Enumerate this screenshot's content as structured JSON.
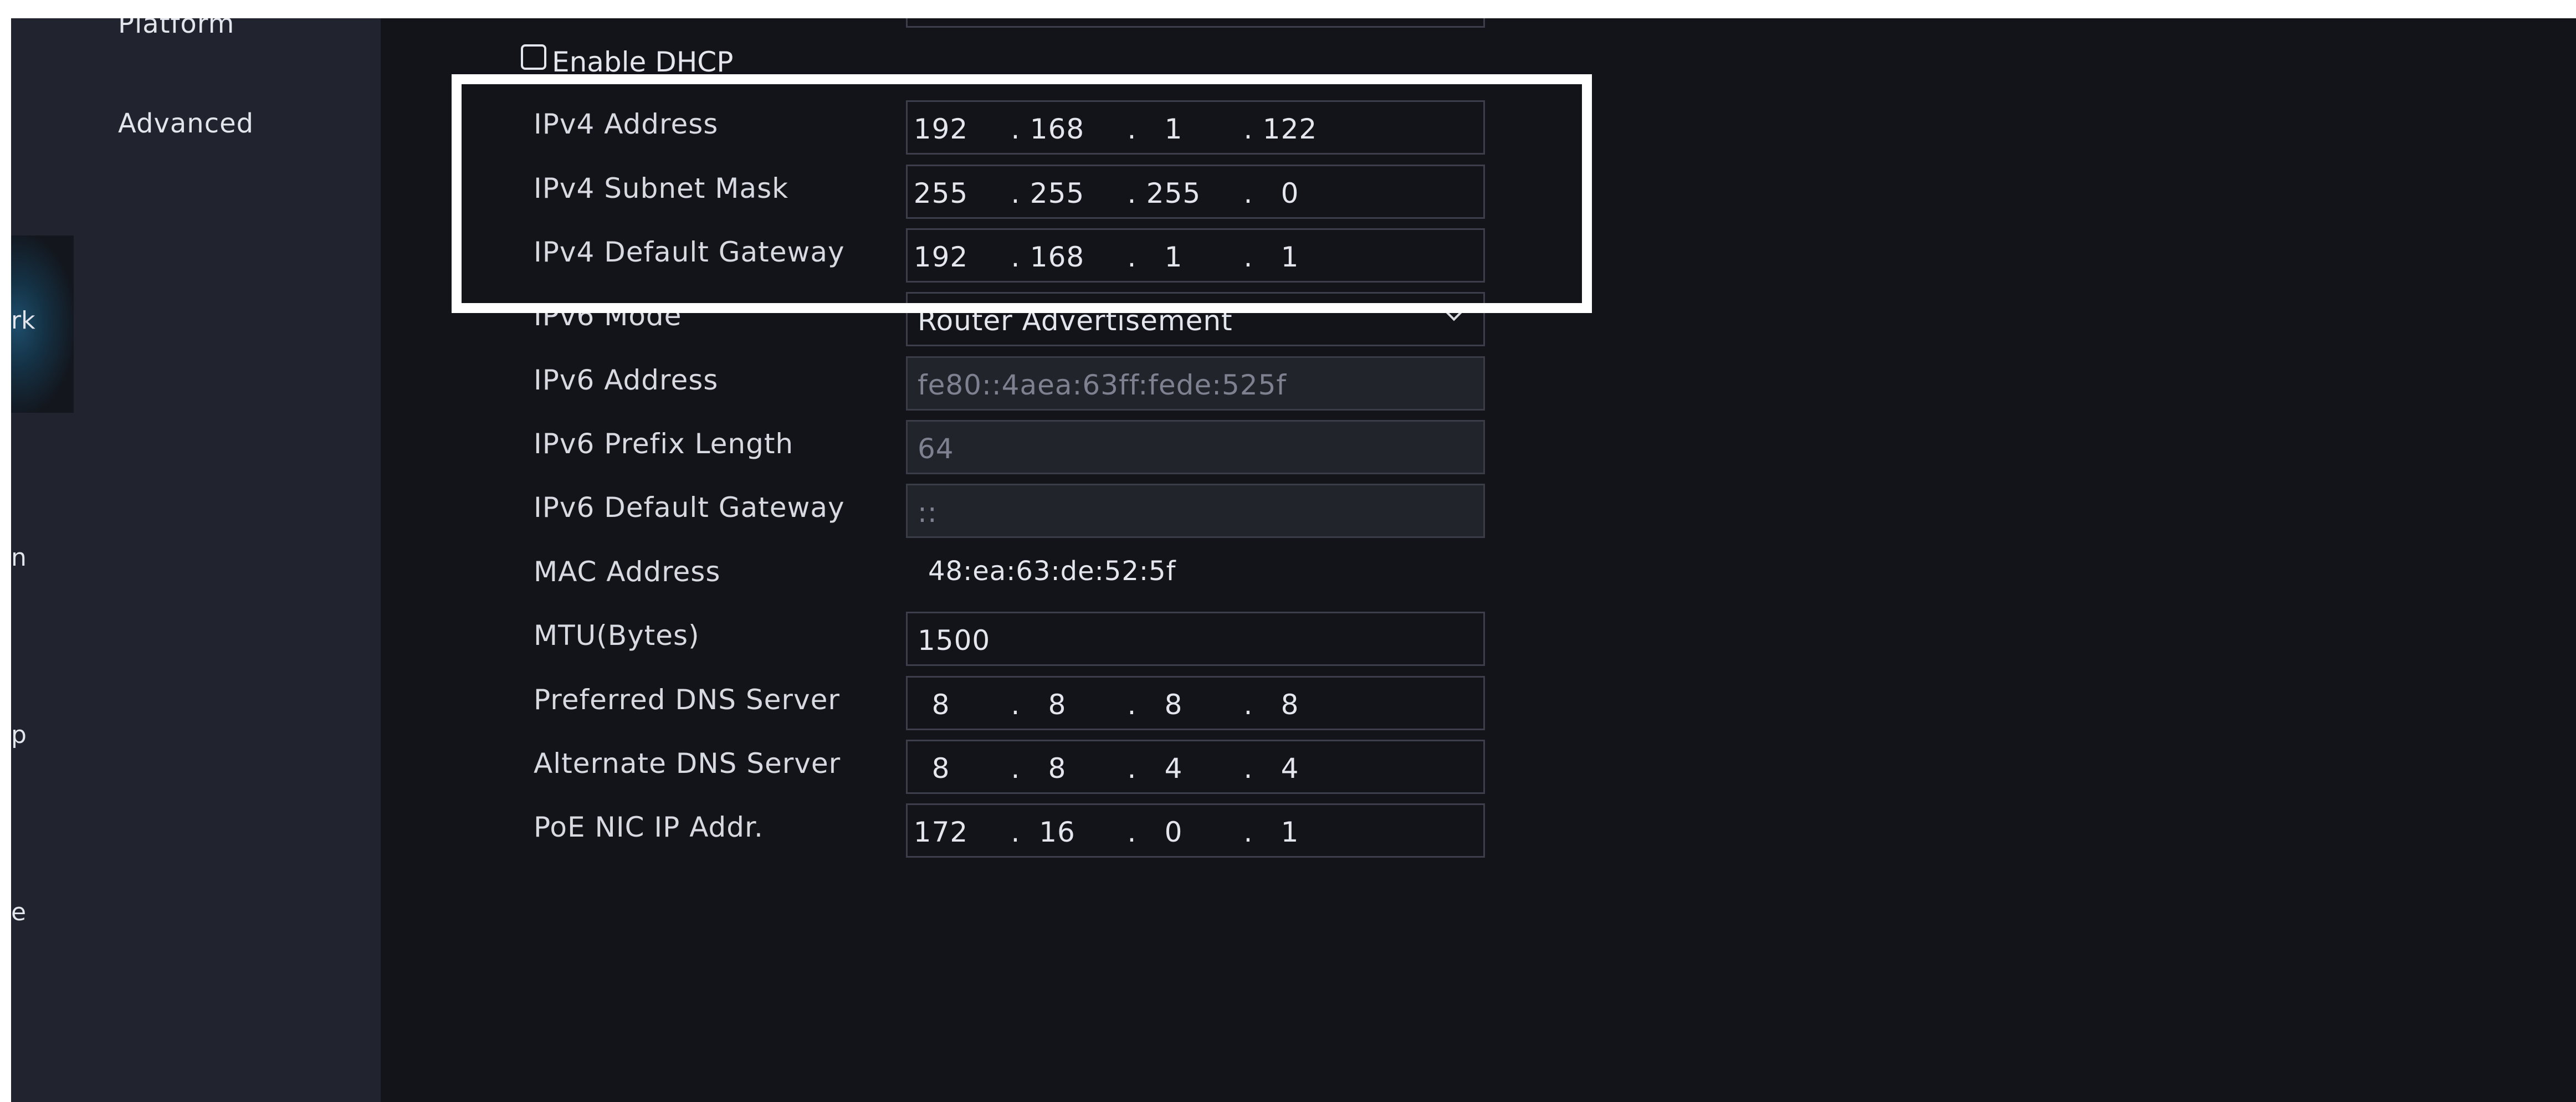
{
  "sidebar": {
    "rail_labels": [
      "rk",
      "n",
      "p",
      "e"
    ],
    "menu": [
      {
        "label": "Platform"
      },
      {
        "label": "Advanced"
      }
    ]
  },
  "form": {
    "dhcp": {
      "label": "Enable DHCP",
      "checked": false
    },
    "ipv4_address": {
      "label": "IPv4 Address",
      "octets": [
        "192",
        "168",
        "1",
        "122"
      ]
    },
    "ipv4_subnet_mask": {
      "label": "IPv4 Subnet Mask",
      "octets": [
        "255",
        "255",
        "255",
        "0"
      ]
    },
    "ipv4_default_gateway": {
      "label": "IPv4 Default Gateway",
      "octets": [
        "192",
        "168",
        "1",
        "1"
      ]
    },
    "ipv6_mode": {
      "label": "IPv6 Mode",
      "value": "Router Advertisement"
    },
    "ipv6_address": {
      "label": "IPv6 Address",
      "value": "fe80::4aea:63ff:fede:525f"
    },
    "ipv6_prefix_length": {
      "label": "IPv6 Prefix Length",
      "value": "64"
    },
    "ipv6_default_gateway": {
      "label": "IPv6 Default Gateway",
      "value": "::"
    },
    "mac_address": {
      "label": "MAC Address",
      "value": "48:ea:63:de:52:5f"
    },
    "mtu": {
      "label": "MTU(Bytes)",
      "value": "1500"
    },
    "preferred_dns": {
      "label": "Preferred DNS Server",
      "octets": [
        "8",
        "8",
        "8",
        "8"
      ]
    },
    "alternate_dns": {
      "label": "Alternate DNS Server",
      "octets": [
        "8",
        "8",
        "4",
        "4"
      ]
    },
    "poe_nic_ip": {
      "label": "PoE NIC IP Addr.",
      "octets": [
        "172",
        "16",
        "0",
        "1"
      ]
    },
    "ip_separator": "."
  },
  "colors": {
    "background": "#13141a",
    "panel": "#21242e",
    "highlight_frame": "#ffffff"
  }
}
